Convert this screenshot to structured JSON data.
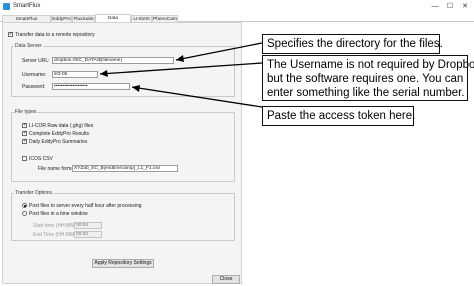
{
  "window": {
    "title": "SmartFlux",
    "minimize": "—",
    "maximize": "☐",
    "close": "✕"
  },
  "tabs": [
    {
      "label": "SmartFlux Connection"
    },
    {
      "label": "EddyPro"
    },
    {
      "label": "FluxSuite"
    },
    {
      "label": "Data Repository"
    },
    {
      "label": "LI-8100"
    },
    {
      "label": "PhenoCam"
    }
  ],
  "transfer_checkbox": {
    "label": "Transfer data to a remote repository",
    "checked": "✓"
  },
  "data_server": {
    "title": "Data Server",
    "server_url_label": "Server URL:",
    "server_url_value": "dropbox://EC_DATA/${filename}",
    "username_label": "Username:",
    "username_value": "sf3-05",
    "password_label": "Password:",
    "password_value": "••••••••••••••••••••"
  },
  "file_types": {
    "title": "File types",
    "items": [
      {
        "label": "LI-COR Raw data (.ghg) files",
        "checked": "✓"
      },
      {
        "label": "Complete EddyPro Results",
        "checked": "✓"
      },
      {
        "label": "Daily EddyPro Summaries",
        "checked": "✓"
      }
    ],
    "icos_label": "ICOS CSV",
    "file_name_format_label": "File name format:",
    "file_name_format_value": "XYZab_EC_${endtime:lamp}_L1_F1.csv"
  },
  "transfer_options": {
    "title": "Transfer Options",
    "radio1": "Post files to server every half hour after processing",
    "radio2": "Post files in a time window",
    "start_time_label": "Start time (HH:MM)",
    "start_time_value": "00:00",
    "end_time_label": "End Time (HH:MM)",
    "end_time_value": "00:00"
  },
  "apply_button": "Apply Repository Settings",
  "close_button": "Close",
  "callouts": {
    "directory": "Specifies the directory for the files.",
    "username": [
      "The Username is not required by Dropbox,",
      "but the software requires one. You can",
      "enter something like the serial number."
    ],
    "token": "Paste the access token here."
  }
}
